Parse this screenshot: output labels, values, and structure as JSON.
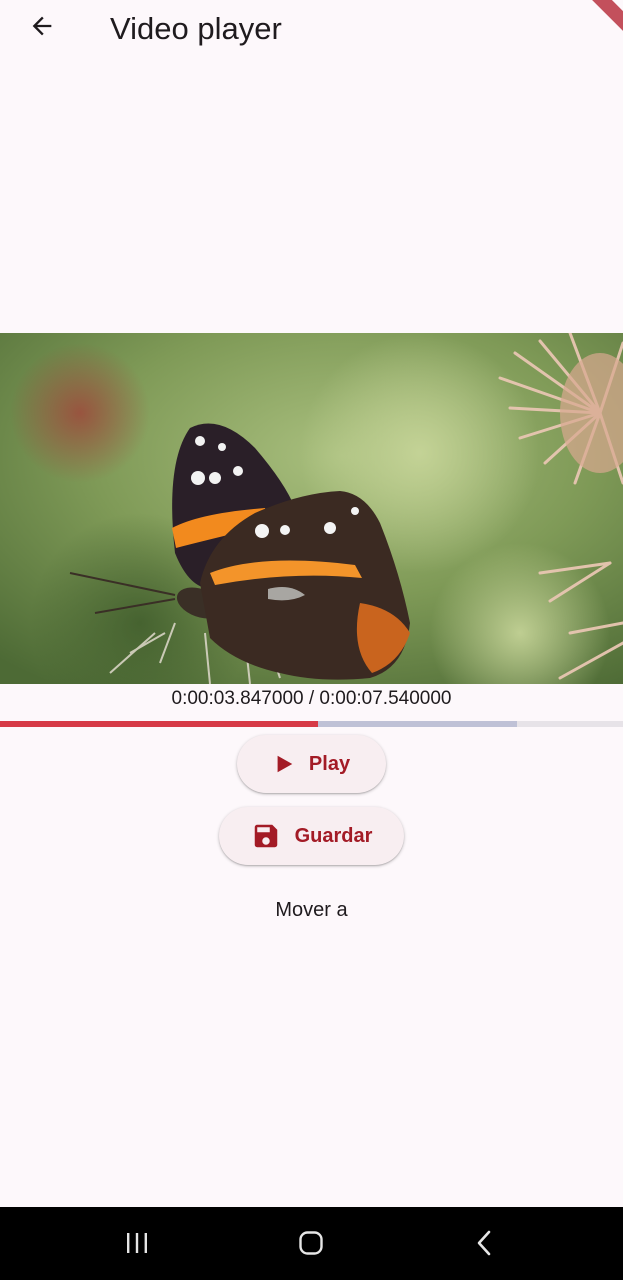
{
  "app_bar": {
    "title": "Video player",
    "back_icon": "arrow-back-icon"
  },
  "video": {
    "position": "0:00:03.847000",
    "duration": "0:00:07.540000",
    "time_text": "0:00:03.847000 / 0:00:07.540000",
    "played_fraction": 0.51,
    "buffered_fraction": 0.83,
    "colors": {
      "played": "#d63a46",
      "buffered": "#bfc1d6",
      "track": "#e7e3e8"
    }
  },
  "controls": {
    "play_label": "Play",
    "play_icon": "play-icon",
    "save_label": "Guardar",
    "save_icon": "save-icon",
    "seek_label": "Mover a"
  },
  "theme": {
    "accent": "#a31b26",
    "button_bg": "#f8eef1",
    "background": "#fdf8fb"
  },
  "system_nav": {
    "recents_icon": "recents-icon",
    "home_icon": "home-icon",
    "back_icon": "nav-back-icon"
  }
}
